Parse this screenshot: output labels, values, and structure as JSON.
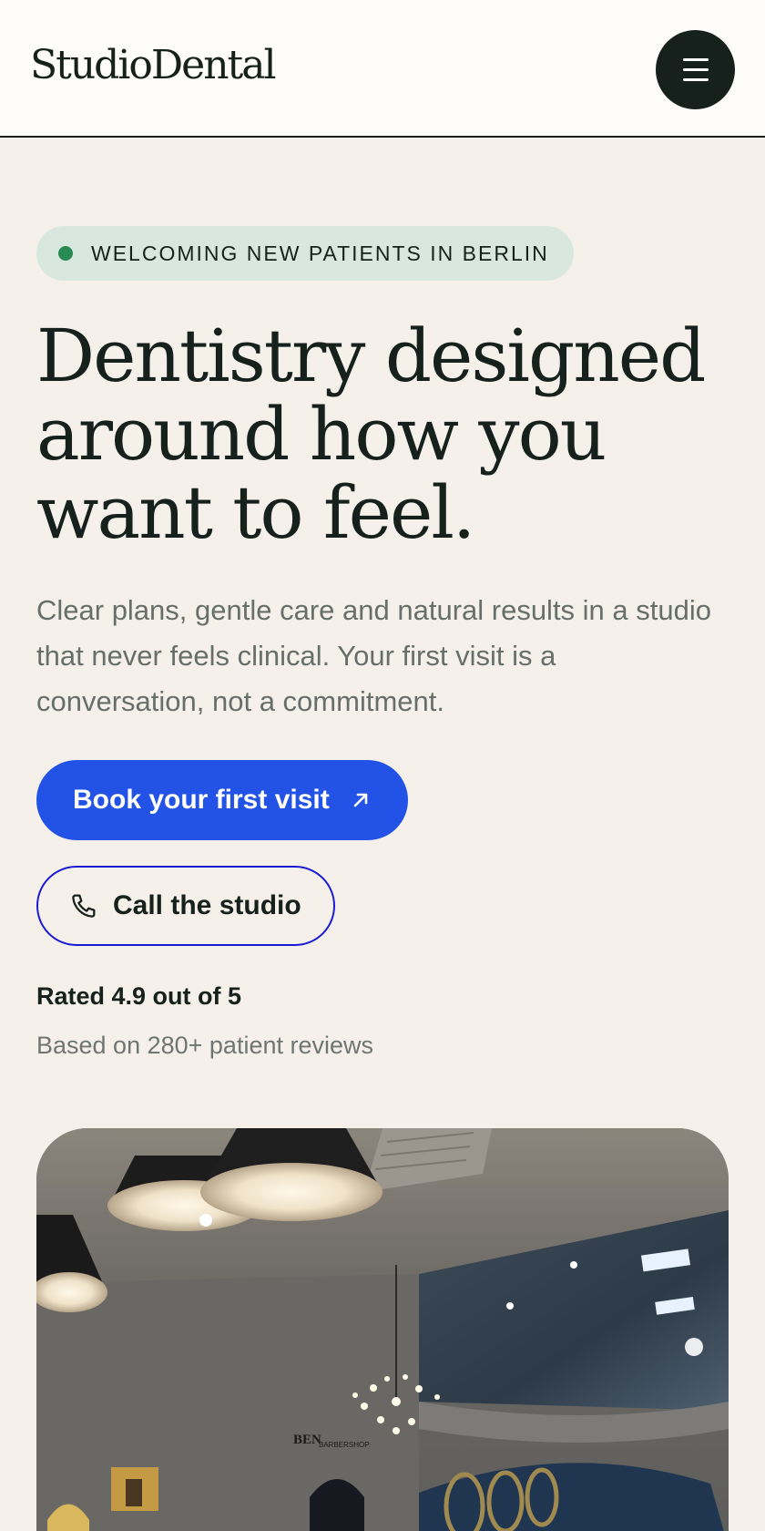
{
  "header": {
    "logo": "StudioDental",
    "menu_icon": "hamburger-menu-icon"
  },
  "hero": {
    "badge": "WELCOMING NEW PATIENTS IN BERLIN",
    "headline": "Dentistry designed around how you want to feel.",
    "intro": "Clear plans, gentle care and natural results in a studio that never feels clinical. Your first visit is a conversation, not a commitment.",
    "primary_cta": "Book your first visit",
    "primary_cta_icon": "arrow-up-right-icon",
    "secondary_cta": "Call the studio",
    "secondary_cta_icon": "phone-icon",
    "rating": "Rated 4.9 out of 5",
    "reviews": "Based on 280+ patient reviews"
  },
  "photo": {
    "sign_main": "BEN",
    "sign_sub": "BARBERSHOP"
  },
  "colors": {
    "background": "#f5f1ea",
    "ink": "#16211d",
    "accent_blue": "#2353e6",
    "badge_bg": "#d8e8de",
    "badge_dot": "#2a8a56"
  }
}
